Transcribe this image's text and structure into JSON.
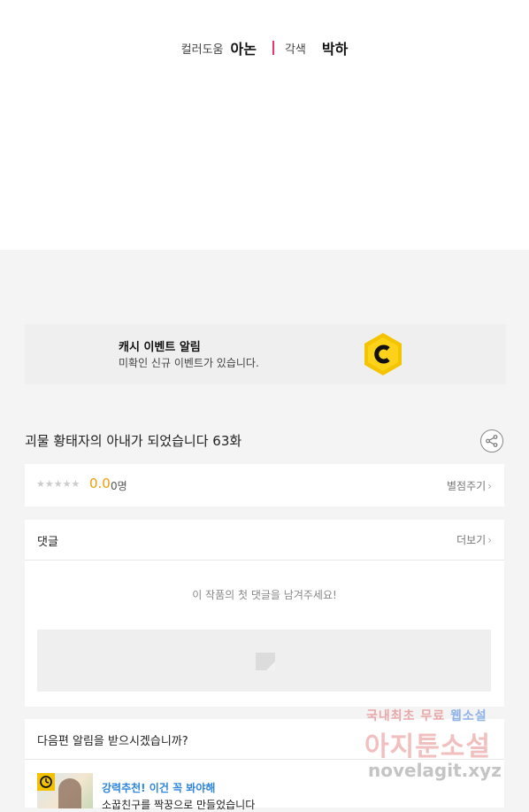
{
  "credits": {
    "color_role": "컬러도움",
    "color_name": "아논",
    "adapt_role": "각색",
    "adapt_name": "박하"
  },
  "cash_banner": {
    "title": "캐시 이벤트 알림",
    "subtitle": "미확인 신규 이벤트가 있습니다.",
    "icon": "cash-coin-icon",
    "icon_color": "#f5c400"
  },
  "episode": {
    "title": "괴물 황태자의 아내가 되었습니다 63화"
  },
  "rating": {
    "stars": "★★★★★",
    "star_value": 0,
    "score": "0.0",
    "count": "0명",
    "action_label": "별점주기"
  },
  "comments": {
    "header": "댓글",
    "more_label": "더보기",
    "empty_message": "이 작품의 첫 댓글을 남겨주세요!"
  },
  "next_episode": {
    "question": "다음편 알림을 받으시겠습니까?",
    "promo": "강력추천! 이건 꼭 봐야해",
    "description": "소꿉친구를 짝꿍으로 만들었습니다"
  },
  "watermark": {
    "line1_a": "국내최초 무료 ",
    "line1_b": "웹소설",
    "line2": "아지툰소설",
    "line3": "novelagit.xyz"
  },
  "colors": {
    "accent_pink": "#e8386d",
    "rating_orange": "#f29c00",
    "promo_blue": "#2e86de"
  }
}
